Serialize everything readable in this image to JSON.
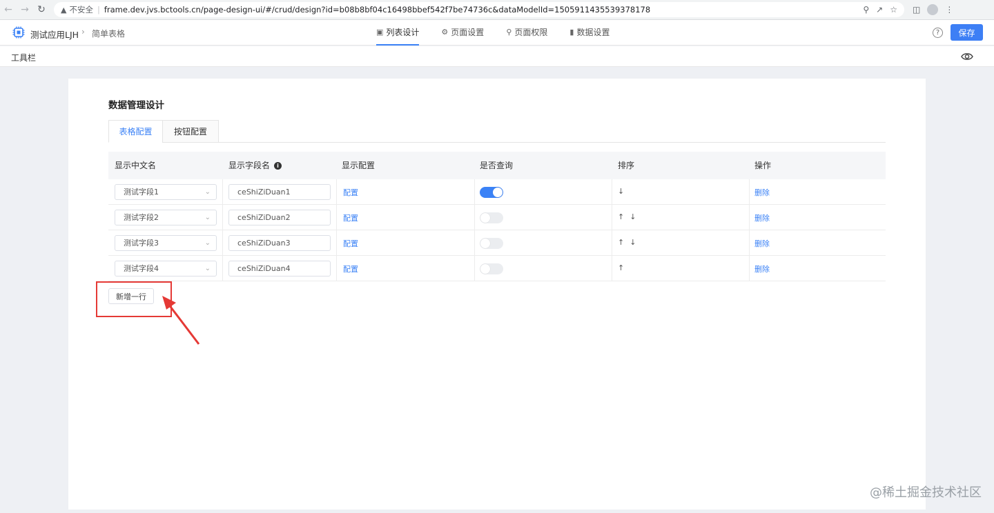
{
  "browser": {
    "insecure_label": "不安全",
    "url": "frame.dev.jvs.bctools.cn/page-design-ui/#/crud/design?id=b08b8bf04c16498bbef542f7be74736c&dataModelId=1505911435539378178"
  },
  "header": {
    "app_name": "测试应用LJH",
    "breadcrumb_page": "简单表格",
    "tabs": [
      {
        "label": "列表设计",
        "icon": "monitor-icon",
        "active": true
      },
      {
        "label": "页面设置",
        "icon": "gear-icon",
        "active": false
      },
      {
        "label": "页面权限",
        "icon": "key-icon",
        "active": false
      },
      {
        "label": "数据设置",
        "icon": "bar-chart-icon",
        "active": false
      }
    ],
    "save_label": "保存",
    "accent_color": "#3d7ff5"
  },
  "toolbar": {
    "label": "工具栏"
  },
  "main": {
    "title": "数据管理设计",
    "subtabs": [
      {
        "label": "表格配置",
        "active": true
      },
      {
        "label": "按钮配置",
        "active": false
      }
    ],
    "columns": [
      "显示中文名",
      "显示字段名",
      "显示配置",
      "是否查询",
      "排序",
      "操作"
    ],
    "rows": [
      {
        "name": "测试字段1",
        "field": "ceShiZiDuan1",
        "config": "配置",
        "query": true,
        "up": "",
        "down": "↓",
        "action": "删除"
      },
      {
        "name": "测试字段2",
        "field": "ceShiZiDuan2",
        "config": "配置",
        "query": false,
        "up": "↑",
        "down": "↓",
        "action": "删除"
      },
      {
        "name": "测试字段3",
        "field": "ceShiZiDuan3",
        "config": "配置",
        "query": false,
        "up": "↑",
        "down": "↓",
        "action": "删除"
      },
      {
        "name": "测试字段4",
        "field": "ceShiZiDuan4",
        "config": "配置",
        "query": false,
        "up": "↑",
        "down": "",
        "action": "删除"
      }
    ],
    "add_row_label": "新增一行"
  },
  "watermark": "@稀土掘金技术社区"
}
